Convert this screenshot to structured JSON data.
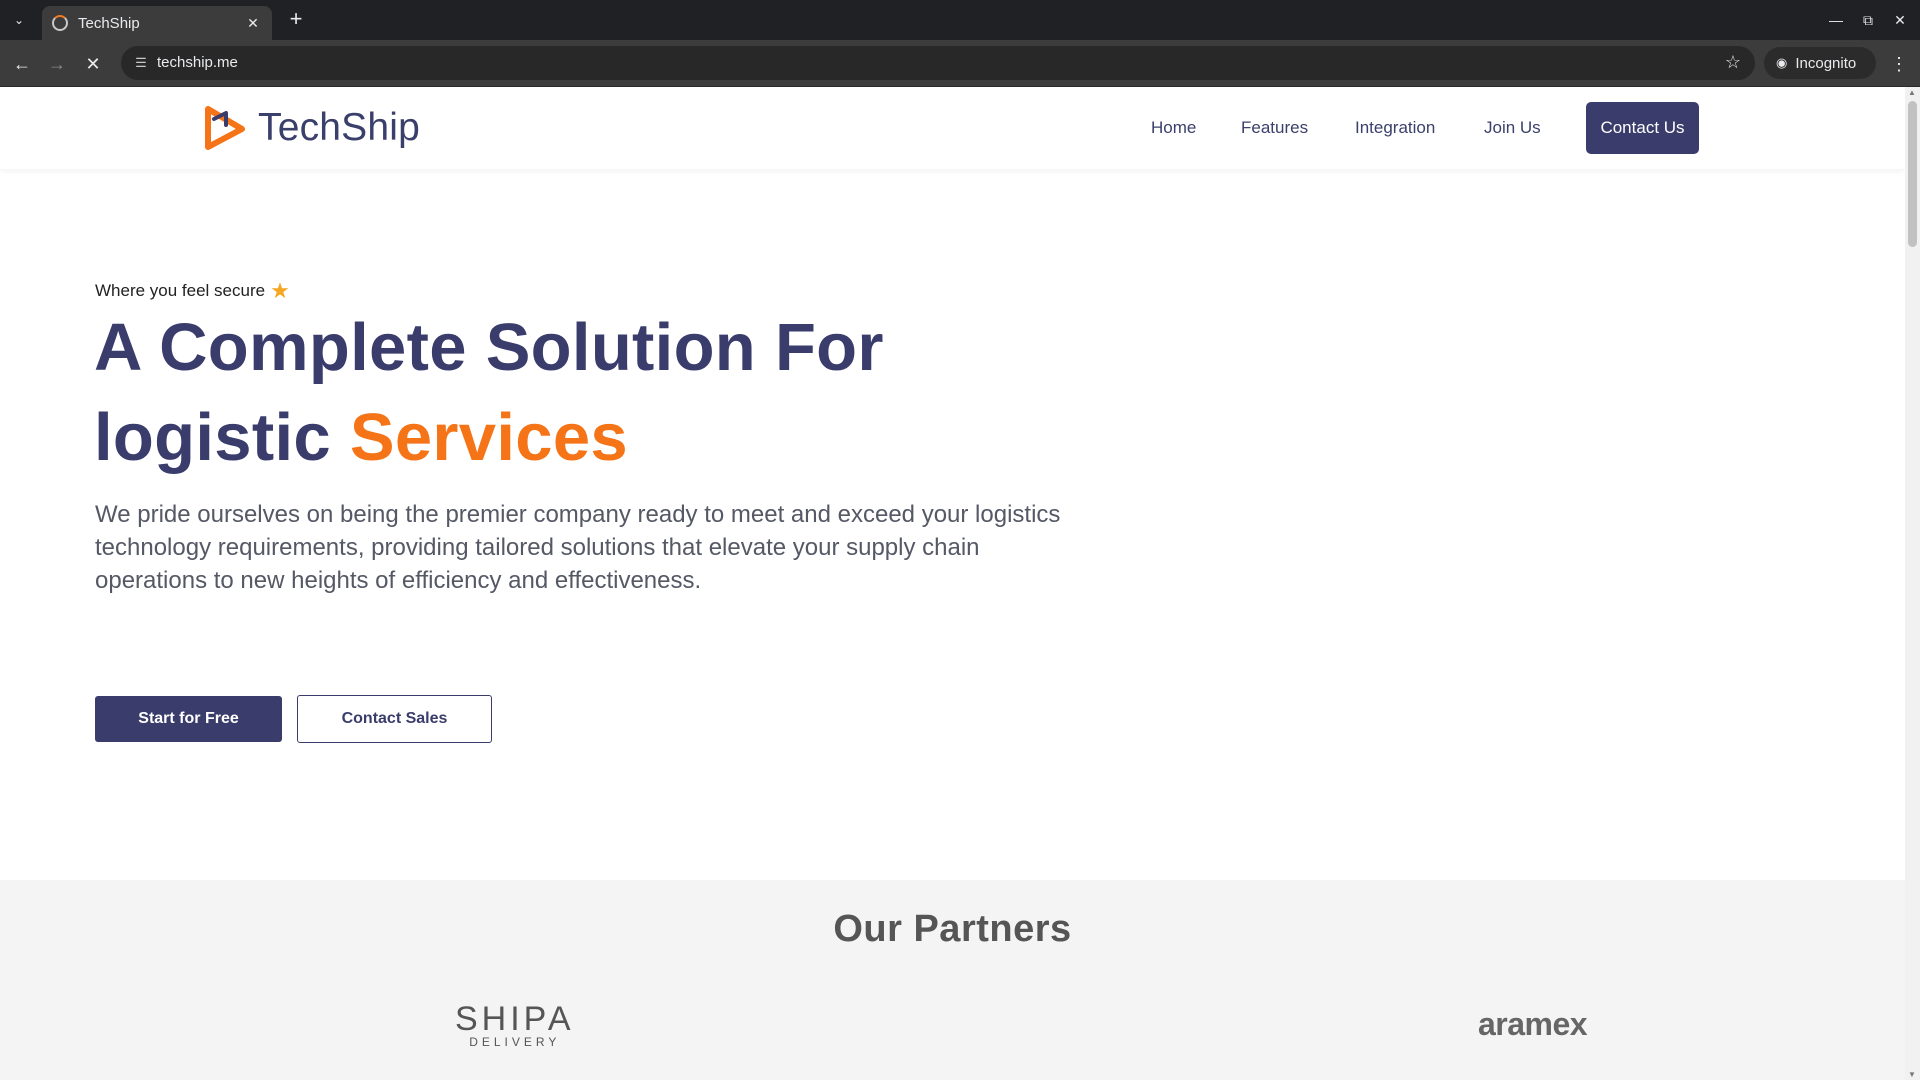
{
  "browser": {
    "tab_title": "TechShip",
    "url": "techship.me",
    "incognito_label": "Incognito"
  },
  "site": {
    "brand": "TechShip",
    "nav": [
      "Home",
      "Features",
      "Integration",
      "Join Us"
    ],
    "contact_label": "Contact Us",
    "accent_color": "#f57418",
    "primary_color": "#3a3c6c"
  },
  "hero": {
    "tagline": "Where you feel secure",
    "title_line1": "A Complete Solution For",
    "title_line2_plain": "logistic",
    "title_line2_accent": "Services",
    "description": "We pride ourselves on being the premier company ready to meet and exceed your logistics technology requirements, providing tailored solutions that elevate your supply chain operations to new heights of efficiency and effectiveness.",
    "primary_button": "Start for Free",
    "secondary_button": "Contact Sales"
  },
  "partners": {
    "title": "Our Partners",
    "logos": [
      {
        "name": "SHIPA",
        "sub": "DELIVERY"
      },
      {
        "name": "aramex"
      }
    ]
  }
}
